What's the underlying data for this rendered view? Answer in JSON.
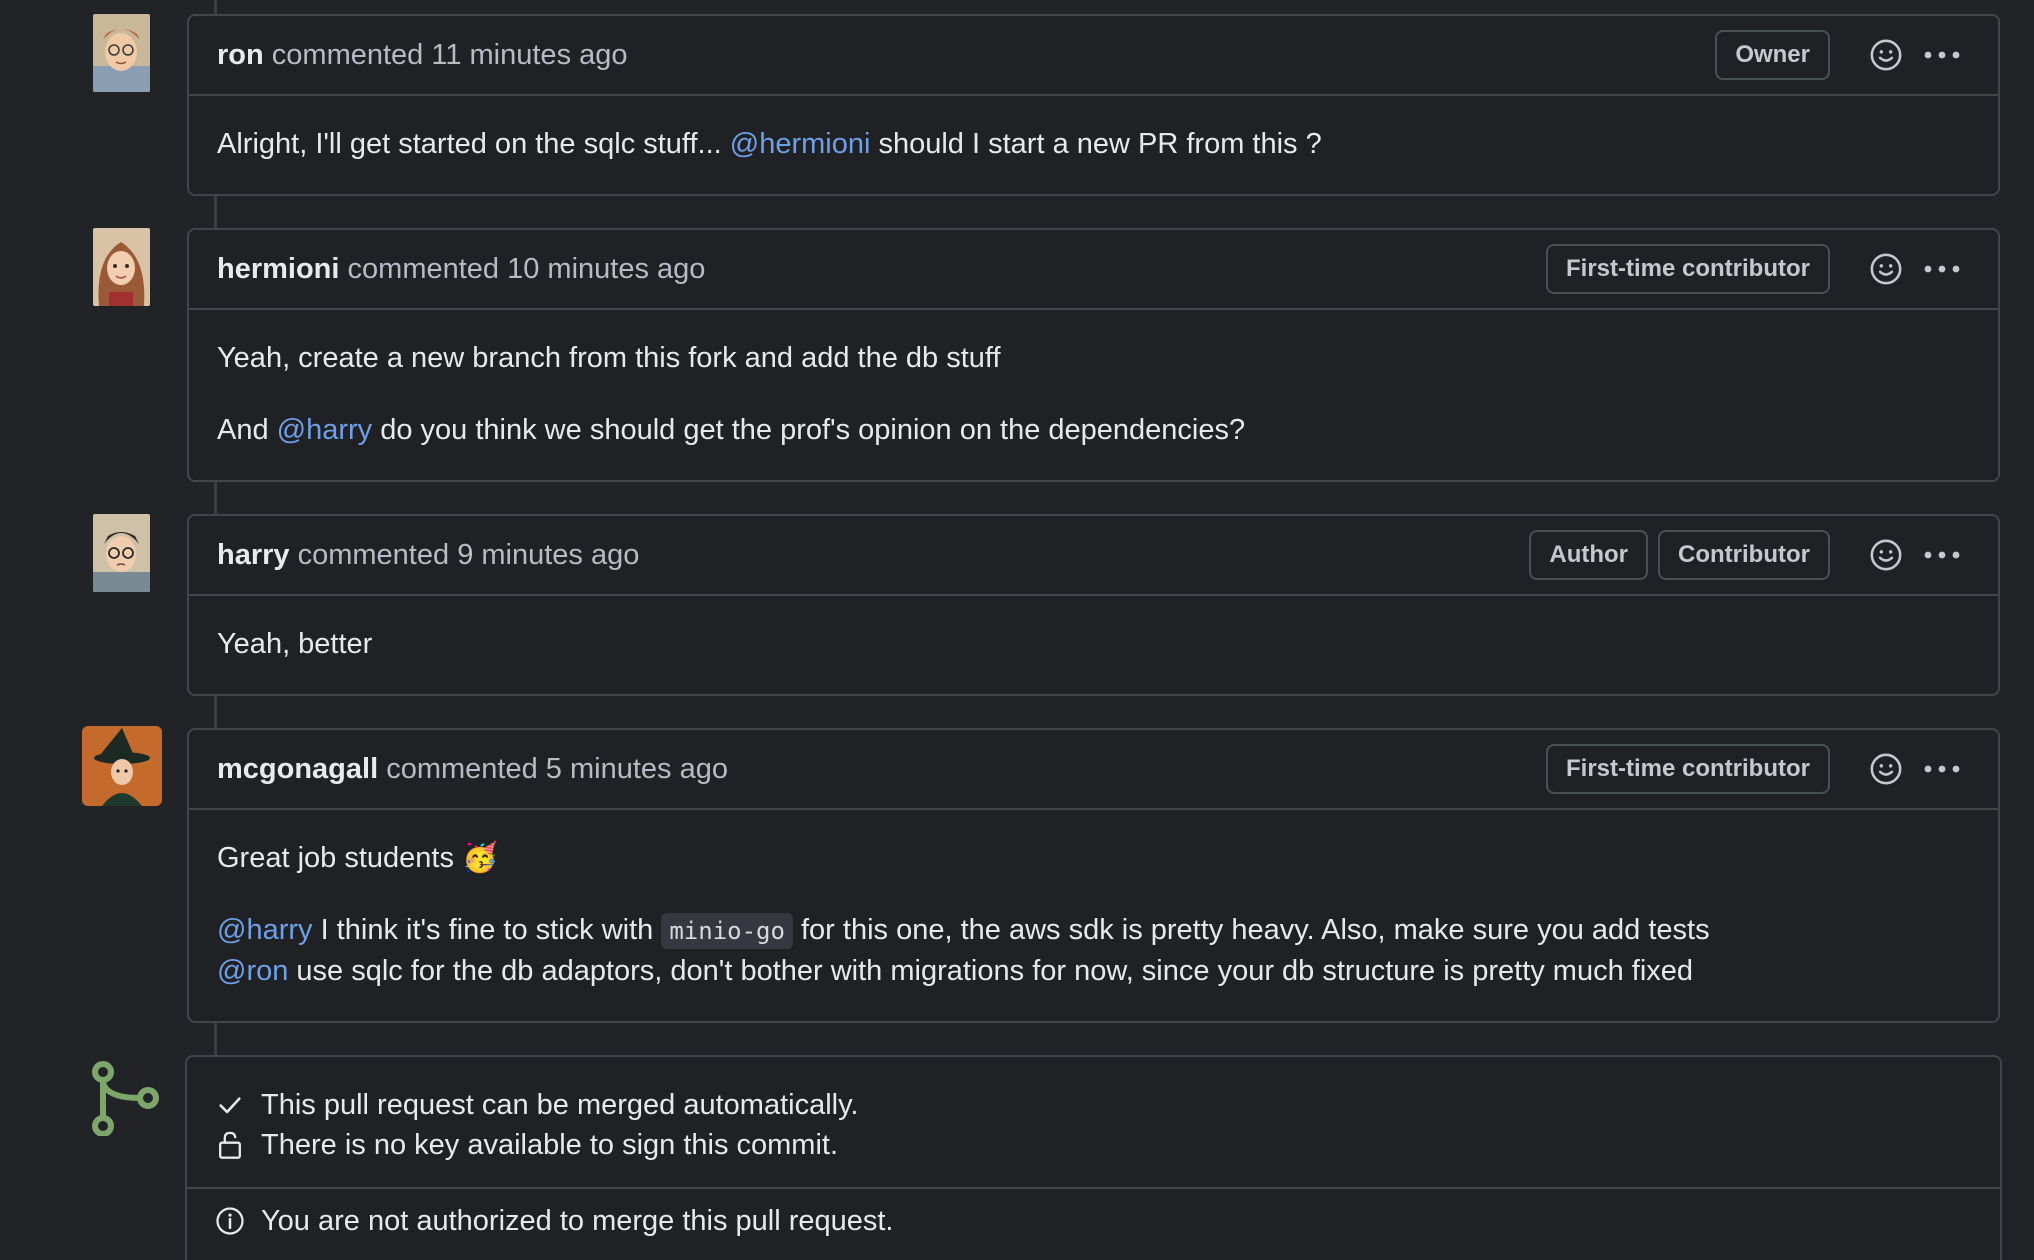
{
  "comments": [
    {
      "author": "ron",
      "verb": "commented",
      "time": "11 minutes ago",
      "badges": [
        "Owner"
      ],
      "body": [
        [
          {
            "t": "text",
            "v": "Alright, I'll get started on the sqlc stuff... "
          },
          {
            "t": "mention",
            "v": "@hermioni"
          },
          {
            "t": "text",
            "v": " should I start a new PR from this ?"
          }
        ]
      ]
    },
    {
      "author": "hermioni",
      "verb": "commented",
      "time": "10 minutes ago",
      "badges": [
        "First-time contributor"
      ],
      "body": [
        [
          {
            "t": "text",
            "v": "Yeah, create a new branch from this fork and add the db stuff"
          }
        ],
        [
          {
            "t": "text",
            "v": "And "
          },
          {
            "t": "mention",
            "v": "@harry"
          },
          {
            "t": "text",
            "v": " do you think we should get the prof's opinion on the dependencies?"
          }
        ]
      ]
    },
    {
      "author": "harry",
      "verb": "commented",
      "time": "9 minutes ago",
      "badges": [
        "Author",
        "Contributor"
      ],
      "body": [
        [
          {
            "t": "text",
            "v": "Yeah, better"
          }
        ]
      ]
    },
    {
      "author": "mcgonagall",
      "verb": "commented",
      "time": "5 minutes ago",
      "badges": [
        "First-time contributor"
      ],
      "body": [
        [
          {
            "t": "text",
            "v": "Great job students "
          },
          {
            "t": "emoji",
            "v": "🥳"
          }
        ],
        [
          {
            "t": "mention",
            "v": "@harry"
          },
          {
            "t": "text",
            "v": " I think it's fine to stick with "
          },
          {
            "t": "code",
            "v": "minio-go"
          },
          {
            "t": "text",
            "v": " for this one, the aws sdk is pretty heavy. Also, make sure you add tests"
          },
          {
            "t": "br"
          },
          {
            "t": "mention",
            "v": "@ron"
          },
          {
            "t": "text",
            "v": " use sqlc for the db adaptors, don't bother with migrations for now, since your db structure is pretty much fixed"
          }
        ]
      ]
    }
  ],
  "merge": {
    "mergeable": "This pull request can be merged automatically.",
    "no_key": "There is no key available to sign this commit.",
    "not_authorized": "You are not authorized to merge this pull request."
  },
  "icons": {
    "reaction": "smiley-icon",
    "more": "kebab-horizontal-icon",
    "merge": "git-merge-icon",
    "check": "check-icon",
    "lock": "unlock-icon",
    "info": "info-icon"
  },
  "colors": {
    "background": "#212327",
    "mention": "#6f9fe6",
    "merge_icon": "#7ea66a"
  }
}
